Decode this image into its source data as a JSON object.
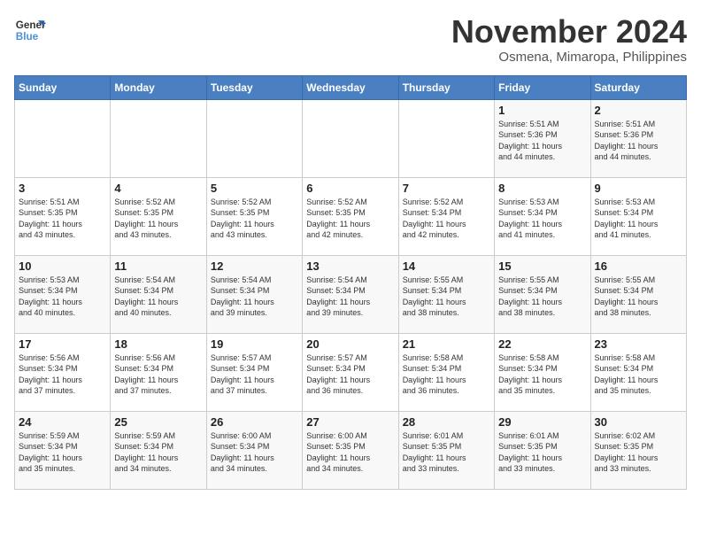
{
  "logo": {
    "line1": "General",
    "line2": "Blue"
  },
  "title": "November 2024",
  "subtitle": "Osmena, Mimaropa, Philippines",
  "days_header": [
    "Sunday",
    "Monday",
    "Tuesday",
    "Wednesday",
    "Thursday",
    "Friday",
    "Saturday"
  ],
  "weeks": [
    [
      {
        "day": "",
        "info": ""
      },
      {
        "day": "",
        "info": ""
      },
      {
        "day": "",
        "info": ""
      },
      {
        "day": "",
        "info": ""
      },
      {
        "day": "",
        "info": ""
      },
      {
        "day": "1",
        "info": "Sunrise: 5:51 AM\nSunset: 5:36 PM\nDaylight: 11 hours\nand 44 minutes."
      },
      {
        "day": "2",
        "info": "Sunrise: 5:51 AM\nSunset: 5:36 PM\nDaylight: 11 hours\nand 44 minutes."
      }
    ],
    [
      {
        "day": "3",
        "info": "Sunrise: 5:51 AM\nSunset: 5:35 PM\nDaylight: 11 hours\nand 43 minutes."
      },
      {
        "day": "4",
        "info": "Sunrise: 5:52 AM\nSunset: 5:35 PM\nDaylight: 11 hours\nand 43 minutes."
      },
      {
        "day": "5",
        "info": "Sunrise: 5:52 AM\nSunset: 5:35 PM\nDaylight: 11 hours\nand 43 minutes."
      },
      {
        "day": "6",
        "info": "Sunrise: 5:52 AM\nSunset: 5:35 PM\nDaylight: 11 hours\nand 42 minutes."
      },
      {
        "day": "7",
        "info": "Sunrise: 5:52 AM\nSunset: 5:34 PM\nDaylight: 11 hours\nand 42 minutes."
      },
      {
        "day": "8",
        "info": "Sunrise: 5:53 AM\nSunset: 5:34 PM\nDaylight: 11 hours\nand 41 minutes."
      },
      {
        "day": "9",
        "info": "Sunrise: 5:53 AM\nSunset: 5:34 PM\nDaylight: 11 hours\nand 41 minutes."
      }
    ],
    [
      {
        "day": "10",
        "info": "Sunrise: 5:53 AM\nSunset: 5:34 PM\nDaylight: 11 hours\nand 40 minutes."
      },
      {
        "day": "11",
        "info": "Sunrise: 5:54 AM\nSunset: 5:34 PM\nDaylight: 11 hours\nand 40 minutes."
      },
      {
        "day": "12",
        "info": "Sunrise: 5:54 AM\nSunset: 5:34 PM\nDaylight: 11 hours\nand 39 minutes."
      },
      {
        "day": "13",
        "info": "Sunrise: 5:54 AM\nSunset: 5:34 PM\nDaylight: 11 hours\nand 39 minutes."
      },
      {
        "day": "14",
        "info": "Sunrise: 5:55 AM\nSunset: 5:34 PM\nDaylight: 11 hours\nand 38 minutes."
      },
      {
        "day": "15",
        "info": "Sunrise: 5:55 AM\nSunset: 5:34 PM\nDaylight: 11 hours\nand 38 minutes."
      },
      {
        "day": "16",
        "info": "Sunrise: 5:55 AM\nSunset: 5:34 PM\nDaylight: 11 hours\nand 38 minutes."
      }
    ],
    [
      {
        "day": "17",
        "info": "Sunrise: 5:56 AM\nSunset: 5:34 PM\nDaylight: 11 hours\nand 37 minutes."
      },
      {
        "day": "18",
        "info": "Sunrise: 5:56 AM\nSunset: 5:34 PM\nDaylight: 11 hours\nand 37 minutes."
      },
      {
        "day": "19",
        "info": "Sunrise: 5:57 AM\nSunset: 5:34 PM\nDaylight: 11 hours\nand 37 minutes."
      },
      {
        "day": "20",
        "info": "Sunrise: 5:57 AM\nSunset: 5:34 PM\nDaylight: 11 hours\nand 36 minutes."
      },
      {
        "day": "21",
        "info": "Sunrise: 5:58 AM\nSunset: 5:34 PM\nDaylight: 11 hours\nand 36 minutes."
      },
      {
        "day": "22",
        "info": "Sunrise: 5:58 AM\nSunset: 5:34 PM\nDaylight: 11 hours\nand 35 minutes."
      },
      {
        "day": "23",
        "info": "Sunrise: 5:58 AM\nSunset: 5:34 PM\nDaylight: 11 hours\nand 35 minutes."
      }
    ],
    [
      {
        "day": "24",
        "info": "Sunrise: 5:59 AM\nSunset: 5:34 PM\nDaylight: 11 hours\nand 35 minutes."
      },
      {
        "day": "25",
        "info": "Sunrise: 5:59 AM\nSunset: 5:34 PM\nDaylight: 11 hours\nand 34 minutes."
      },
      {
        "day": "26",
        "info": "Sunrise: 6:00 AM\nSunset: 5:34 PM\nDaylight: 11 hours\nand 34 minutes."
      },
      {
        "day": "27",
        "info": "Sunrise: 6:00 AM\nSunset: 5:35 PM\nDaylight: 11 hours\nand 34 minutes."
      },
      {
        "day": "28",
        "info": "Sunrise: 6:01 AM\nSunset: 5:35 PM\nDaylight: 11 hours\nand 33 minutes."
      },
      {
        "day": "29",
        "info": "Sunrise: 6:01 AM\nSunset: 5:35 PM\nDaylight: 11 hours\nand 33 minutes."
      },
      {
        "day": "30",
        "info": "Sunrise: 6:02 AM\nSunset: 5:35 PM\nDaylight: 11 hours\nand 33 minutes."
      }
    ]
  ]
}
